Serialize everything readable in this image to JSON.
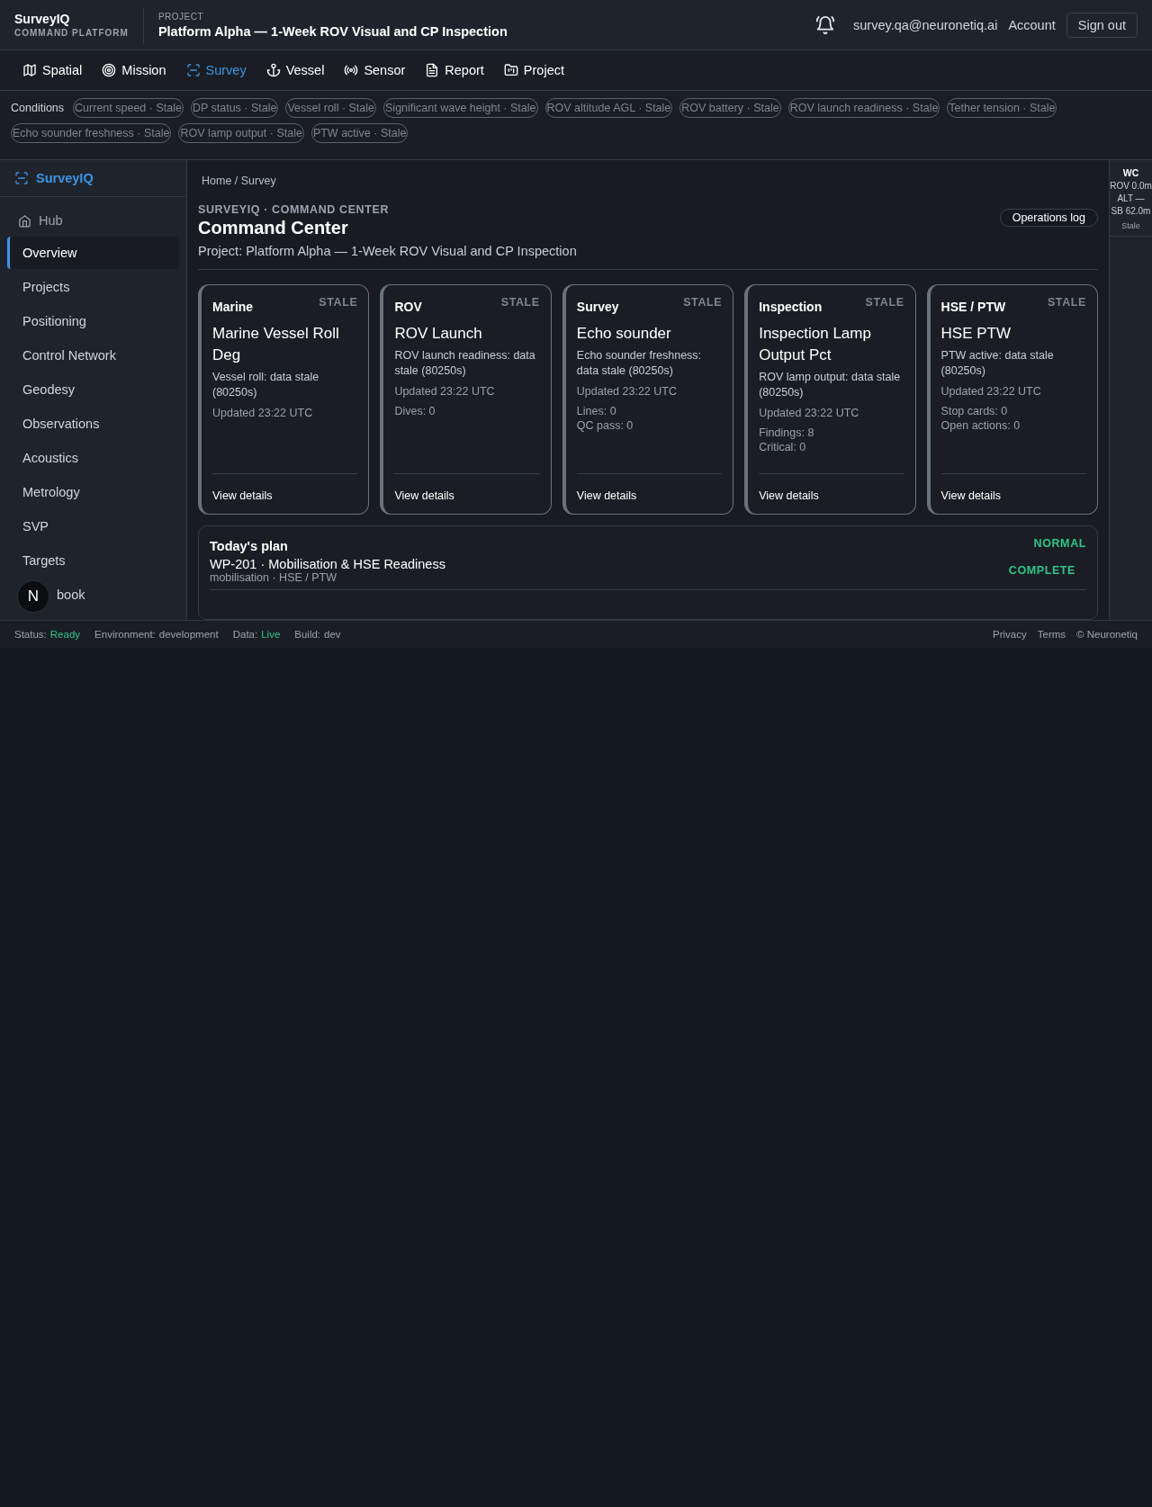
{
  "brand": {
    "name": "SurveyIQ",
    "subtitle": "COMMAND PLATFORM"
  },
  "project": {
    "label": "PROJECT",
    "title": "Platform Alpha — 1-Week ROV Visual and CP Inspection"
  },
  "user": {
    "email": "survey.qa@neuronetiq.ai",
    "account": "Account",
    "sign_out": "Sign out"
  },
  "nav_tabs": [
    {
      "label": "Spatial",
      "selected": false
    },
    {
      "label": "Mission",
      "selected": false
    },
    {
      "label": "Survey",
      "selected": true
    },
    {
      "label": "Vessel",
      "selected": false
    },
    {
      "label": "Sensor",
      "selected": false
    },
    {
      "label": "Report",
      "selected": false
    },
    {
      "label": "Project",
      "selected": false
    }
  ],
  "conditions": {
    "label": "Conditions",
    "chips": [
      "Current speed · Stale",
      "DP status · Stale",
      "Vessel roll · Stale",
      "Significant wave height · Stale",
      "ROV altitude AGL · Stale",
      "ROV battery · Stale",
      "ROV launch readiness · Stale",
      "Tether tension · Stale",
      "Echo sounder freshness · Stale",
      "ROV lamp output · Stale",
      "PTW active · Stale"
    ]
  },
  "sidebar": {
    "title": "SurveyIQ",
    "hub": "Hub",
    "items": [
      {
        "label": "Overview",
        "selected": true
      },
      {
        "label": "Projects",
        "selected": false
      },
      {
        "label": "Positioning",
        "selected": false
      },
      {
        "label": "Control Network",
        "selected": false
      },
      {
        "label": "Geodesy",
        "selected": false
      },
      {
        "label": "Observations",
        "selected": false
      },
      {
        "label": "Acoustics",
        "selected": false
      },
      {
        "label": "Metrology",
        "selected": false
      },
      {
        "label": "SVP",
        "selected": false
      },
      {
        "label": "Targets",
        "selected": false
      },
      {
        "label": "book",
        "selected": false
      }
    ]
  },
  "badge": "N",
  "breadcrumb": "Home / Survey",
  "page": {
    "eyebrow": "SURVEYIQ · COMMAND CENTER",
    "title": "Command Center",
    "subtitle": "Project: Platform Alpha — 1-Week ROV Visual and CP Inspection",
    "action": "Operations log"
  },
  "cards": [
    {
      "category": "Marine",
      "status": "STALE",
      "title": "Marine Vessel Roll Deg",
      "detail": "Vessel roll: data stale (80250s)",
      "updated": "Updated 23:22 UTC",
      "link": "View details"
    },
    {
      "category": "ROV",
      "status": "STALE",
      "title": "ROV Launch",
      "detail": "ROV launch readiness: data stale (80250s)",
      "updated": "Updated 23:22 UTC",
      "stats": [
        "Dives: 0"
      ],
      "link": "View details"
    },
    {
      "category": "Survey",
      "status": "STALE",
      "title": "Echo sounder",
      "detail": "Echo sounder freshness: data stale (80250s)",
      "updated": "Updated 23:22 UTC",
      "stats": [
        "Lines: 0",
        "QC pass: 0"
      ],
      "link": "View details"
    },
    {
      "category": "Inspection",
      "status": "STALE",
      "title": "Inspection Lamp Output Pct",
      "detail": "ROV lamp output: data stale (80250s)",
      "updated": "Updated 23:22 UTC",
      "stats": [
        "Findings: 8",
        "Critical: 0"
      ],
      "link": "View details"
    },
    {
      "category": "HSE / PTW",
      "status": "STALE",
      "title": "HSE PTW",
      "detail": "PTW active: data stale (80250s)",
      "updated": "Updated 23:22 UTC",
      "stats": [
        "Stop cards: 0",
        "Open actions: 0"
      ],
      "link": "View details"
    }
  ],
  "plan": {
    "title": "Today's plan",
    "status": "NORMAL",
    "items": [
      {
        "title": "WP-201 · Mobilisation & HSE Readiness",
        "meta": "mobilisation · HSE / PTW",
        "status": "COMPLETE"
      }
    ]
  },
  "rail": {
    "title": "WC",
    "lines": [
      "ROV 0.0m",
      "ALT —",
      "SB 62.0m"
    ],
    "state": "Stale"
  },
  "status_bar": {
    "items": [
      {
        "label": "Status:",
        "value": "Ready",
        "highlight": true
      },
      {
        "label": "Environment:",
        "value": "development",
        "highlight": false
      },
      {
        "label": "Data:",
        "value": "Live",
        "highlight": true
      },
      {
        "label": "Build:",
        "value": "dev",
        "highlight": false
      }
    ],
    "links": [
      "Privacy",
      "Terms",
      "© Neuronetiq"
    ]
  }
}
